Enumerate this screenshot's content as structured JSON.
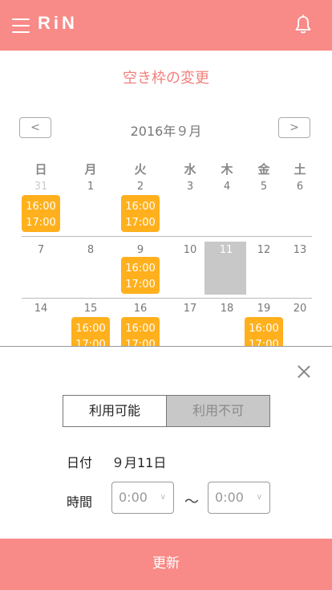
{
  "header": {
    "logo": "RiN",
    "brand_color": "#f88a87"
  },
  "page": {
    "title": "空き枠の変更"
  },
  "calendar": {
    "prev_label": "<",
    "next_label": ">",
    "month": "2016年９月",
    "weekdays": [
      "日",
      "月",
      "火",
      "水",
      "木",
      "金",
      "土"
    ],
    "weeks": [
      [
        "31",
        "1",
        "2",
        "3",
        "4",
        "5",
        "6"
      ],
      [
        "7",
        "8",
        "9",
        "10",
        "11",
        "12",
        "13"
      ],
      [
        "14",
        "15",
        "16",
        "17",
        "18",
        "19",
        "20"
      ]
    ],
    "slots": [
      {
        "start": "16:00",
        "end": "17:00"
      },
      {
        "start": "16:00",
        "end": "17:00"
      },
      {
        "start": "16:00",
        "end": "17:00"
      },
      {
        "start": "16:00",
        "end": "17:00"
      },
      {
        "start": "16:00",
        "end": "17:00"
      },
      {
        "start": "16:00",
        "end": "17:00"
      }
    ],
    "slot_color": "#ffb01c"
  },
  "panel": {
    "available_label": "利用可能",
    "unavailable_label": "利用不可",
    "date_label": "日付",
    "date_value": "９月11日",
    "time_label": "時間",
    "start_time": "0:00",
    "end_time": "0:00",
    "range_separator": "〜",
    "submit_label": "更新"
  }
}
